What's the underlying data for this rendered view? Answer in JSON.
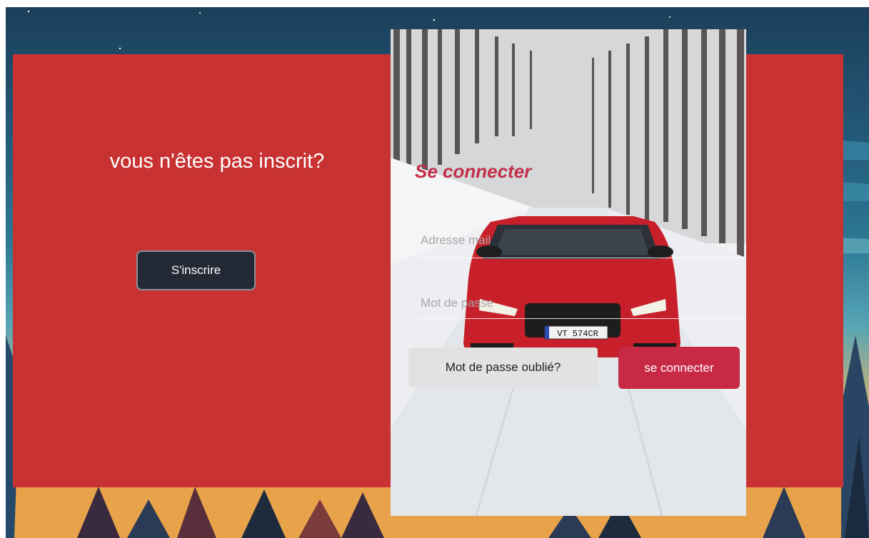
{
  "signup_panel": {
    "title": "vous n'êtes pas inscrit?",
    "signup_label": "S'inscrire"
  },
  "login_form": {
    "title": "Se connecter",
    "email_placeholder": "Adresse mail",
    "password_placeholder": "Mot de passe",
    "forgot_label": "Mot de passe oublié?",
    "submit_label": "se connecter"
  },
  "car": {
    "plate": "VT 574CR"
  },
  "colors": {
    "panel_red": "#c83232",
    "title_red": "#c2304a",
    "submit_red": "#c82a46",
    "signup_dark": "#232a36"
  }
}
